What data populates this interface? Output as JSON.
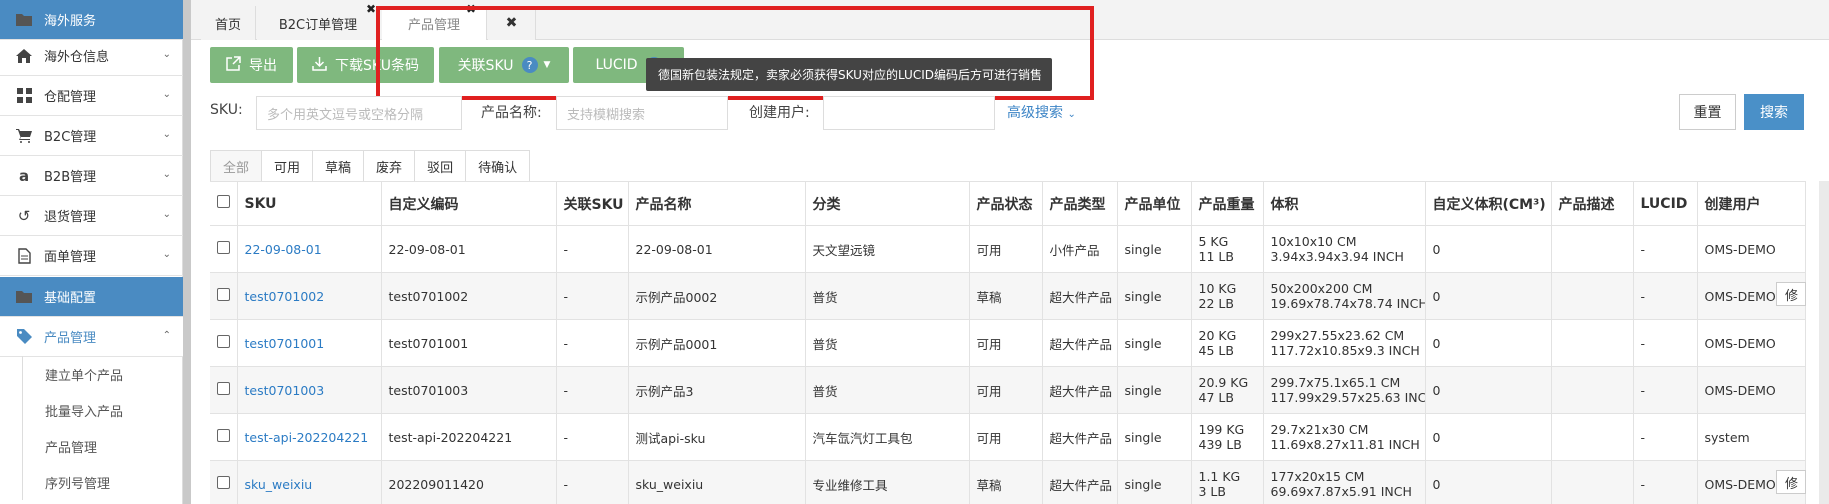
{
  "sidebar": {
    "items": [
      {
        "label": "海外服务",
        "icon": "folder-icon",
        "type": "section",
        "chevron": ""
      },
      {
        "label": "海外仓信息",
        "icon": "home-icon",
        "type": "item",
        "chevron": "⌄"
      },
      {
        "label": "仓配管理",
        "icon": "grid-icon",
        "type": "item",
        "chevron": "⌄"
      },
      {
        "label": "B2C管理",
        "icon": "cart-icon",
        "type": "item",
        "chevron": "⌄"
      },
      {
        "label": "B2B管理",
        "icon": "amazon-icon",
        "type": "item",
        "chevron": "⌄"
      },
      {
        "label": "退货管理",
        "icon": "undo-icon",
        "type": "item",
        "chevron": "⌄"
      },
      {
        "label": "面单管理",
        "icon": "document-icon",
        "type": "item",
        "chevron": "⌄"
      },
      {
        "label": "基础配置",
        "icon": "folder-icon",
        "type": "section",
        "chevron": ""
      },
      {
        "label": "产品管理",
        "icon": "tag-icon",
        "type": "active",
        "chevron": "⌃"
      }
    ],
    "sub_items": [
      "建立单个产品",
      "批量导入产品",
      "产品管理",
      "序列号管理"
    ]
  },
  "tabs": [
    {
      "label": "首页"
    },
    {
      "label": "B2C订单管理"
    },
    {
      "label": "产品管理"
    }
  ],
  "toolbar": {
    "export_label": "导出",
    "download_label": "下载SKU条码",
    "link_sku_label": "关联SKU",
    "lucid_label": "LUCID"
  },
  "tooltip": "德国新包装法规定，卖家必须获得SKU对应的LUCID编码后方可进行销售",
  "filters": {
    "sku_label": "SKU:",
    "sku_placeholder": "多个用英文逗号或空格分隔",
    "name_label": "产品名称:",
    "name_placeholder": "支持模糊搜索",
    "user_label": "创建用户:",
    "user_value": "",
    "advanced_label": "高级搜索",
    "reset_label": "重置",
    "search_label": "搜索"
  },
  "status_tabs": [
    "全部",
    "可用",
    "草稿",
    "废弃",
    "驳回",
    "待确认"
  ],
  "table": {
    "columns": [
      "SKU",
      "自定义编码",
      "关联SKU",
      "产品名称",
      "分类",
      "产品状态",
      "产品类型",
      "产品单位",
      "产品重量",
      "体积",
      "自定义体积(CM³)",
      "产品描述",
      "LUCID",
      "创建用户"
    ],
    "rows": [
      {
        "sku": "22-09-08-01",
        "code": "22-09-08-01",
        "link": "-",
        "name": "22-09-08-01",
        "cat": "天文望远镜",
        "status": "可用",
        "type": "小件产品",
        "unit": "single",
        "w1": "5 KG",
        "w2": "11 LB",
        "v1": "10x10x10 CM",
        "v2": "3.94x3.94x3.94 INCH",
        "cv": "0",
        "desc": "",
        "lucid": "-",
        "user": "OMS-DEMO"
      },
      {
        "sku": "test0701002",
        "code": "test0701002",
        "link": "-",
        "name": "示例产品0002",
        "cat": "普货",
        "status": "草稿",
        "type": "超大件产品",
        "unit": "single",
        "w1": "10 KG",
        "w2": "22 LB",
        "v1": "50x200x200 CM",
        "v2": "19.69x78.74x78.74 INCH",
        "cv": "0",
        "desc": "",
        "lucid": "-",
        "user": "OMS-DEMO"
      },
      {
        "sku": "test0701001",
        "code": "test0701001",
        "link": "-",
        "name": "示例产品0001",
        "cat": "普货",
        "status": "可用",
        "type": "超大件产品",
        "unit": "single",
        "w1": "20 KG",
        "w2": "45 LB",
        "v1": "299x27.55x23.62 CM",
        "v2": "117.72x10.85x9.3 INCH",
        "cv": "0",
        "desc": "",
        "lucid": "-",
        "user": "OMS-DEMO"
      },
      {
        "sku": "test0701003",
        "code": "test0701003",
        "link": "-",
        "name": "示例产品3",
        "cat": "普货",
        "status": "可用",
        "type": "超大件产品",
        "unit": "single",
        "w1": "20.9 KG",
        "w2": "47 LB",
        "v1": "299.7x75.1x65.1 CM",
        "v2": "117.99x29.57x25.63 INCH",
        "cv": "0",
        "desc": "",
        "lucid": "-",
        "user": "OMS-DEMO"
      },
      {
        "sku": "test-api-202204221",
        "code": "test-api-202204221",
        "link": "-",
        "name": "测试api-sku",
        "cat": "汽车氙汽灯工具包",
        "status": "可用",
        "type": "超大件产品",
        "unit": "single",
        "w1": "199 KG",
        "w2": "439 LB",
        "v1": "29.7x21x30 CM",
        "v2": "11.69x8.27x11.81 INCH",
        "cv": "0",
        "desc": "",
        "lucid": "-",
        "user": "system"
      },
      {
        "sku": "sku_weixiu",
        "code": "202209011420",
        "link": "-",
        "name": "sku_weixiu",
        "cat": "专业维修工具",
        "status": "草稿",
        "type": "超大件产品",
        "unit": "single",
        "w1": "1.1 KG",
        "w2": "3 LB",
        "v1": "177x20x15 CM",
        "v2": "69.69x7.87x5.91 INCH",
        "cv": "0",
        "desc": "",
        "lucid": "-",
        "user": "OMS-DEMO"
      }
    ],
    "edit_label": "修"
  }
}
